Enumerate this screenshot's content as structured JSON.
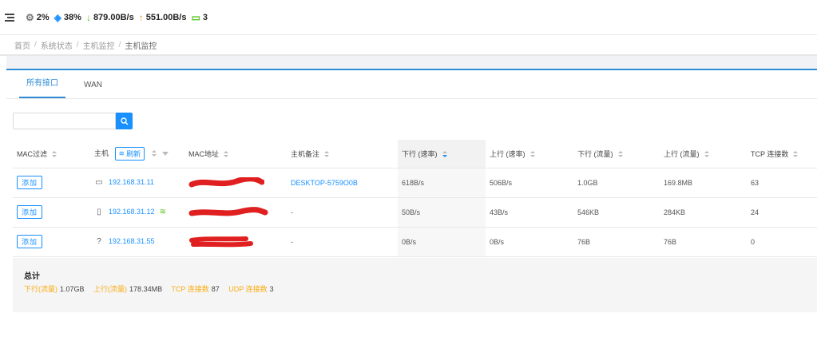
{
  "header": {
    "cpu": "2%",
    "memory": "38%",
    "download_speed": "879.00B/s",
    "upload_speed": "551.00B/s",
    "devices": "3"
  },
  "breadcrumb": [
    "首页",
    "系统状态",
    "主机监控",
    "主机监控"
  ],
  "tabs": [
    {
      "label": "所有接口",
      "active": true
    },
    {
      "label": "WAN",
      "active": false
    }
  ],
  "search": {
    "value": "",
    "placeholder": ""
  },
  "table": {
    "headers": {
      "mac_filter": "MAC过滤",
      "host": "主机",
      "refresh": "刷新",
      "mac": "MAC地址",
      "note": "主机备注",
      "down_rate": "下行 (速率)",
      "up_rate": "上行 (速率)",
      "down_traffic": "下行 (流量)",
      "up_traffic": "上行 (流量)",
      "tcp": "TCP 连接数"
    },
    "add_label": "添加",
    "rows": [
      {
        "device": "desktop-icon",
        "ip": "192.168.31.11",
        "wifi": false,
        "note": "DESKTOP-5759O0B",
        "down_rate": "618B/s",
        "up_rate": "506B/s",
        "down_traffic": "1.0GB",
        "up_traffic": "169.8MB",
        "tcp": "63"
      },
      {
        "device": "phone-icon",
        "ip": "192.168.31.12",
        "wifi": true,
        "note": "-",
        "down_rate": "50B/s",
        "up_rate": "43B/s",
        "down_traffic": "546KB",
        "up_traffic": "284KB",
        "tcp": "24"
      },
      {
        "device": "unknown-device-icon",
        "ip": "192.168.31.55",
        "wifi": false,
        "note": "-",
        "down_rate": "0B/s",
        "up_rate": "0B/s",
        "down_traffic": "76B",
        "up_traffic": "76B",
        "tcp": "0"
      }
    ]
  },
  "summary": {
    "title": "总计",
    "down_label": "下行(流量)",
    "down_value": "1.07GB",
    "up_label": "上行(流量)",
    "up_value": "178.34MB",
    "tcp_label": "TCP 连接数",
    "tcp_value": "87",
    "udp_label": "UDP 连接数",
    "udp_value": "3"
  },
  "colors": {
    "accent": "#1890ff",
    "download": "#52c41a",
    "upload": "#fa8c16",
    "summary_label": "#faad14",
    "redaction": "#e02020"
  }
}
